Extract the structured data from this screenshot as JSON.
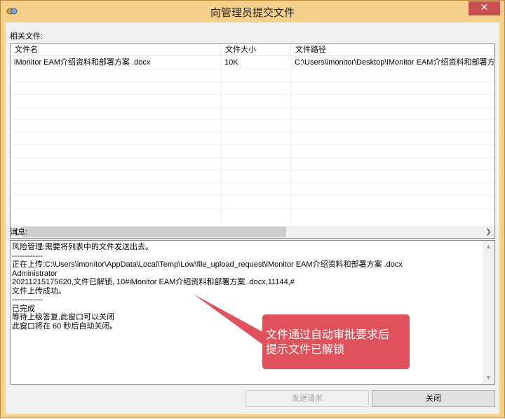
{
  "window": {
    "title": "向管理员提交文件",
    "close_symbol": "✕"
  },
  "files_section": {
    "label": "相关文件:",
    "columns": [
      "文件名",
      "文件大小",
      "文件路径"
    ],
    "rows": [
      {
        "name": "iMonitor EAM介绍资料和部署方案 .docx",
        "size": "10K",
        "path": "C:\\Users\\imonitor\\Desktop\\iMonitor EAM介绍资料和部署方案 .docx"
      }
    ]
  },
  "messages_section": {
    "label": "消息:",
    "lines": [
      "风险管理:需要将列表中的文件发送出去。",
      "------------",
      "正在上传:C:\\Users\\imonitor\\AppData\\Local\\Temp\\Low\\file_upload_request\\iMonitor EAM介绍资料和部署方案 .docx",
      "Administrator",
      "20211215175620,文件已解锁, 10#iMonitor EAM介绍资料和部署方案 .docx,11144,#",
      "文件上传成功。",
      "------------",
      "已完成",
      "等待上级答复,此窗口可以关闭",
      "此窗口将在 60 秒后自动关闭。"
    ]
  },
  "buttons": {
    "send": "发送请求",
    "close": "关闭"
  },
  "annotation": {
    "line1": "文件通过自动审批要求后",
    "line2": "提示文件已解锁",
    "color": "#e0525b"
  }
}
